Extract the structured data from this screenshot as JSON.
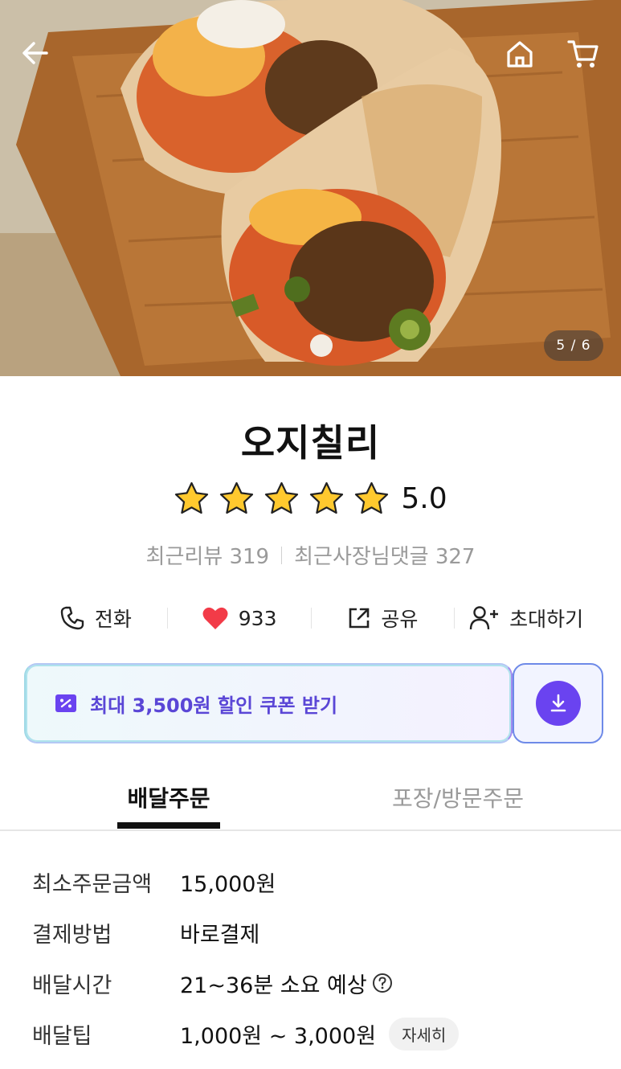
{
  "hero": {
    "image_counter": "5 / 6",
    "icons": {
      "back": "back-arrow-icon",
      "home": "home-icon",
      "cart": "cart-icon"
    }
  },
  "store": {
    "name": "오지칠리",
    "rating": "5.0",
    "rating_stars": 5,
    "recent_reviews": "최근리뷰 319",
    "recent_owner_replies": "최근사장님댓글 327"
  },
  "actions": {
    "call": "전화",
    "likes": "933",
    "share": "공유",
    "invite": "초대하기"
  },
  "coupon": {
    "label": "최대 3,500원 할인 쿠폰 받기",
    "accent": "#5a46d6",
    "button_color": "#6a43f0"
  },
  "tabs": {
    "delivery": "배달주문",
    "takeout": "포장/방문주문",
    "active": "delivery"
  },
  "info": {
    "min_order": {
      "label": "최소주문금액",
      "value": "15,000원"
    },
    "payment": {
      "label": "결제방법",
      "value": "바로결제"
    },
    "delivery_time": {
      "label": "배달시간",
      "value": "21~36분 소요 예상"
    },
    "delivery_tip": {
      "label": "배달팁",
      "value": "1,000원 ~ 3,000원",
      "detail": "자세히"
    }
  }
}
